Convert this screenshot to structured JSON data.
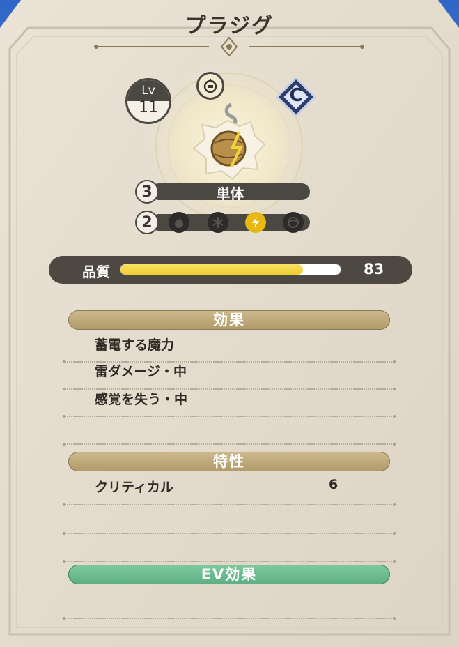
{
  "item": {
    "name": "プラジグ",
    "level_label": "Lv",
    "level": "11",
    "rank": "C",
    "target_count": "3",
    "target_label": "単体",
    "element_count": "2",
    "elements": [
      {
        "name": "fire-icon",
        "active": false
      },
      {
        "name": "ice-icon",
        "active": false
      },
      {
        "name": "lightning-icon",
        "active": true
      },
      {
        "name": "wind-icon",
        "active": false
      }
    ]
  },
  "quality": {
    "label": "品質",
    "value": "83",
    "fill_fraction": 0.83
  },
  "effects": {
    "header": "効果",
    "items": [
      "蓄電する魔力",
      "雷ダメージ・中",
      "感覚を失う・中",
      ""
    ]
  },
  "traits": {
    "header": "特性",
    "items": [
      {
        "name": "クリティカル",
        "value": "6"
      },
      {
        "name": "",
        "value": ""
      },
      {
        "name": "",
        "value": ""
      }
    ]
  },
  "ev_effects": {
    "header": "EV効果",
    "items": [
      ""
    ]
  },
  "colors": {
    "parchment": "#e5ddd1",
    "quality_bar": "#f2d23a",
    "lightning_active": "#e9b810",
    "section_gold": "#bea77a",
    "section_green": "#6fbd91"
  }
}
